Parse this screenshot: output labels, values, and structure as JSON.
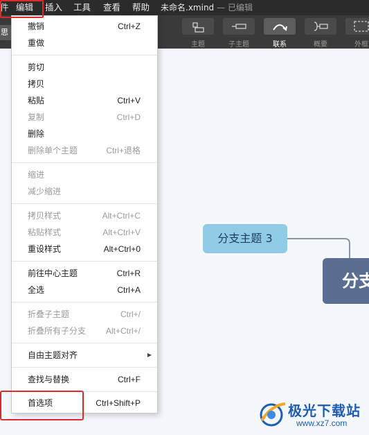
{
  "menubar": {
    "items": [
      "件",
      "编辑",
      "插入",
      "工具",
      "查看",
      "帮助"
    ],
    "doc_name": "未命名.xmind",
    "doc_status": "— 已编辑"
  },
  "toolbar": {
    "left_tab": "思维",
    "buttons": [
      {
        "label": "主题",
        "icon": "topic-icon",
        "active": false
      },
      {
        "label": "子主题",
        "icon": "subtopic-icon",
        "active": false
      },
      {
        "label": "联系",
        "icon": "relationship-icon",
        "active": true
      },
      {
        "label": "概要",
        "icon": "summary-icon",
        "active": false
      },
      {
        "label": "外框",
        "icon": "boundary-icon",
        "active": false
      }
    ]
  },
  "edit_menu": {
    "items": [
      {
        "label": "撤销",
        "shortcut": "Ctrl+Z",
        "disabled": false
      },
      {
        "label": "重做",
        "shortcut": "",
        "disabled": false
      },
      {
        "label": "剪切",
        "shortcut": "",
        "disabled": false
      },
      {
        "label": "拷贝",
        "shortcut": "",
        "disabled": false
      },
      {
        "label": "粘贴",
        "shortcut": "Ctrl+V",
        "disabled": false
      },
      {
        "label": "复制",
        "shortcut": "Ctrl+D",
        "disabled": true
      },
      {
        "label": "删除",
        "shortcut": "",
        "disabled": false
      },
      {
        "label": "删除单个主题",
        "shortcut": "Ctrl+退格",
        "disabled": true
      },
      {
        "label": "缩进",
        "shortcut": "",
        "disabled": true
      },
      {
        "label": "减少缩进",
        "shortcut": "",
        "disabled": true
      },
      {
        "label": "拷贝样式",
        "shortcut": "Alt+Ctrl+C",
        "disabled": true
      },
      {
        "label": "粘贴样式",
        "shortcut": "Alt+Ctrl+V",
        "disabled": true
      },
      {
        "label": "重设样式",
        "shortcut": "Alt+Ctrl+0",
        "disabled": false
      },
      {
        "label": "前往中心主题",
        "shortcut": "Ctrl+R",
        "disabled": false
      },
      {
        "label": "全选",
        "shortcut": "Ctrl+A",
        "disabled": false
      },
      {
        "label": "折叠子主题",
        "shortcut": "Ctrl+/",
        "disabled": true
      },
      {
        "label": "折叠所有子分支",
        "shortcut": "Alt+Ctrl+/",
        "disabled": true
      },
      {
        "label": "自由主题对齐",
        "shortcut": "",
        "disabled": false,
        "submenu": true
      },
      {
        "label": "查找与替换",
        "shortcut": "Ctrl+F",
        "disabled": false
      },
      {
        "label": "首选项",
        "shortcut": "Ctrl+Shift+P",
        "disabled": false
      }
    ]
  },
  "canvas": {
    "branch_topic": "分支主题 3",
    "central_topic": "分支"
  },
  "watermark": {
    "title": "极光下载站",
    "url": "www.xz7.com"
  },
  "colors": {
    "highlight": "#e02a2a",
    "branch_topic": "#8fcbe6",
    "central_topic": "#5a6e92",
    "watermark": "#1d5db4"
  }
}
